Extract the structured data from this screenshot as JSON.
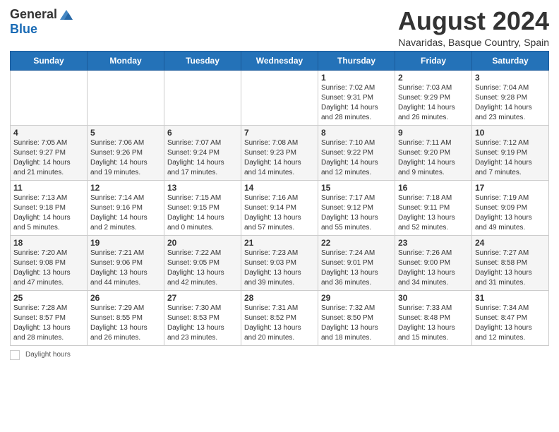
{
  "header": {
    "logo_general": "General",
    "logo_blue": "Blue",
    "title": "August 2024",
    "subtitle": "Navaridas, Basque Country, Spain"
  },
  "days_of_week": [
    "Sunday",
    "Monday",
    "Tuesday",
    "Wednesday",
    "Thursday",
    "Friday",
    "Saturday"
  ],
  "weeks": [
    [
      {
        "day": "",
        "info": ""
      },
      {
        "day": "",
        "info": ""
      },
      {
        "day": "",
        "info": ""
      },
      {
        "day": "",
        "info": ""
      },
      {
        "day": "1",
        "info": "Sunrise: 7:02 AM\nSunset: 9:31 PM\nDaylight: 14 hours and 28 minutes."
      },
      {
        "day": "2",
        "info": "Sunrise: 7:03 AM\nSunset: 9:29 PM\nDaylight: 14 hours and 26 minutes."
      },
      {
        "day": "3",
        "info": "Sunrise: 7:04 AM\nSunset: 9:28 PM\nDaylight: 14 hours and 23 minutes."
      }
    ],
    [
      {
        "day": "4",
        "info": "Sunrise: 7:05 AM\nSunset: 9:27 PM\nDaylight: 14 hours and 21 minutes."
      },
      {
        "day": "5",
        "info": "Sunrise: 7:06 AM\nSunset: 9:26 PM\nDaylight: 14 hours and 19 minutes."
      },
      {
        "day": "6",
        "info": "Sunrise: 7:07 AM\nSunset: 9:24 PM\nDaylight: 14 hours and 17 minutes."
      },
      {
        "day": "7",
        "info": "Sunrise: 7:08 AM\nSunset: 9:23 PM\nDaylight: 14 hours and 14 minutes."
      },
      {
        "day": "8",
        "info": "Sunrise: 7:10 AM\nSunset: 9:22 PM\nDaylight: 14 hours and 12 minutes."
      },
      {
        "day": "9",
        "info": "Sunrise: 7:11 AM\nSunset: 9:20 PM\nDaylight: 14 hours and 9 minutes."
      },
      {
        "day": "10",
        "info": "Sunrise: 7:12 AM\nSunset: 9:19 PM\nDaylight: 14 hours and 7 minutes."
      }
    ],
    [
      {
        "day": "11",
        "info": "Sunrise: 7:13 AM\nSunset: 9:18 PM\nDaylight: 14 hours and 5 minutes."
      },
      {
        "day": "12",
        "info": "Sunrise: 7:14 AM\nSunset: 9:16 PM\nDaylight: 14 hours and 2 minutes."
      },
      {
        "day": "13",
        "info": "Sunrise: 7:15 AM\nSunset: 9:15 PM\nDaylight: 14 hours and 0 minutes."
      },
      {
        "day": "14",
        "info": "Sunrise: 7:16 AM\nSunset: 9:14 PM\nDaylight: 13 hours and 57 minutes."
      },
      {
        "day": "15",
        "info": "Sunrise: 7:17 AM\nSunset: 9:12 PM\nDaylight: 13 hours and 55 minutes."
      },
      {
        "day": "16",
        "info": "Sunrise: 7:18 AM\nSunset: 9:11 PM\nDaylight: 13 hours and 52 minutes."
      },
      {
        "day": "17",
        "info": "Sunrise: 7:19 AM\nSunset: 9:09 PM\nDaylight: 13 hours and 49 minutes."
      }
    ],
    [
      {
        "day": "18",
        "info": "Sunrise: 7:20 AM\nSunset: 9:08 PM\nDaylight: 13 hours and 47 minutes."
      },
      {
        "day": "19",
        "info": "Sunrise: 7:21 AM\nSunset: 9:06 PM\nDaylight: 13 hours and 44 minutes."
      },
      {
        "day": "20",
        "info": "Sunrise: 7:22 AM\nSunset: 9:05 PM\nDaylight: 13 hours and 42 minutes."
      },
      {
        "day": "21",
        "info": "Sunrise: 7:23 AM\nSunset: 9:03 PM\nDaylight: 13 hours and 39 minutes."
      },
      {
        "day": "22",
        "info": "Sunrise: 7:24 AM\nSunset: 9:01 PM\nDaylight: 13 hours and 36 minutes."
      },
      {
        "day": "23",
        "info": "Sunrise: 7:26 AM\nSunset: 9:00 PM\nDaylight: 13 hours and 34 minutes."
      },
      {
        "day": "24",
        "info": "Sunrise: 7:27 AM\nSunset: 8:58 PM\nDaylight: 13 hours and 31 minutes."
      }
    ],
    [
      {
        "day": "25",
        "info": "Sunrise: 7:28 AM\nSunset: 8:57 PM\nDaylight: 13 hours and 28 minutes."
      },
      {
        "day": "26",
        "info": "Sunrise: 7:29 AM\nSunset: 8:55 PM\nDaylight: 13 hours and 26 minutes."
      },
      {
        "day": "27",
        "info": "Sunrise: 7:30 AM\nSunset: 8:53 PM\nDaylight: 13 hours and 23 minutes."
      },
      {
        "day": "28",
        "info": "Sunrise: 7:31 AM\nSunset: 8:52 PM\nDaylight: 13 hours and 20 minutes."
      },
      {
        "day": "29",
        "info": "Sunrise: 7:32 AM\nSunset: 8:50 PM\nDaylight: 13 hours and 18 minutes."
      },
      {
        "day": "30",
        "info": "Sunrise: 7:33 AM\nSunset: 8:48 PM\nDaylight: 13 hours and 15 minutes."
      },
      {
        "day": "31",
        "info": "Sunrise: 7:34 AM\nSunset: 8:47 PM\nDaylight: 13 hours and 12 minutes."
      }
    ]
  ],
  "footer": {
    "daylight_label": "Daylight hours"
  }
}
